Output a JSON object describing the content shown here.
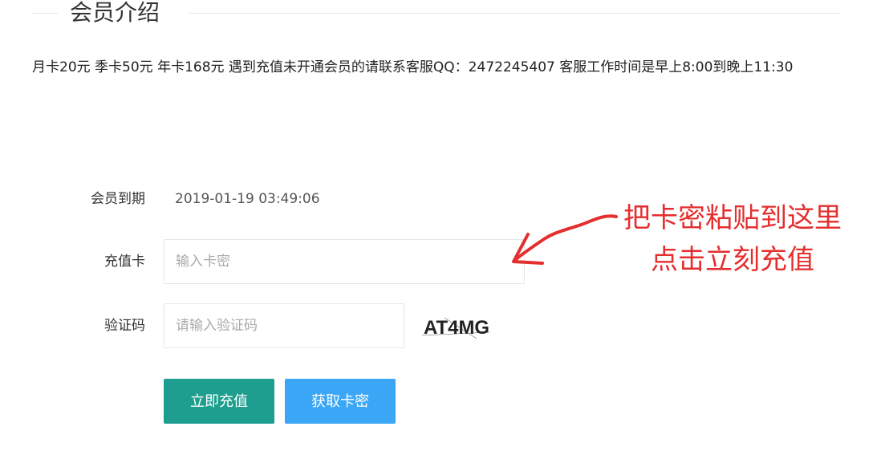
{
  "section": {
    "title": "会员介绍"
  },
  "notice": {
    "text": "月卡20元 季卡50元 年卡168元 遇到充值未开通会员的请联系客服QQ：2472245407 客服工作时间是早上8:00到晚上11:30"
  },
  "form": {
    "expiry": {
      "label": "会员到期",
      "value": "2019-01-19 03:49:06"
    },
    "card": {
      "label": "充值卡",
      "placeholder": "输入卡密",
      "value": ""
    },
    "captcha": {
      "label": "验证码",
      "placeholder": "请输入验证码",
      "value": "",
      "image_text": "AT4MG"
    }
  },
  "buttons": {
    "recharge_label": "立即充值",
    "get_card_label": "获取卡密"
  },
  "annotation": {
    "line1": "把卡密粘贴到这里",
    "line2": "点击立刻充值"
  },
  "colors": {
    "primary_button": "#1e9e8f",
    "secondary_button": "#3aa6f5",
    "annotation": "#e52e2e"
  }
}
